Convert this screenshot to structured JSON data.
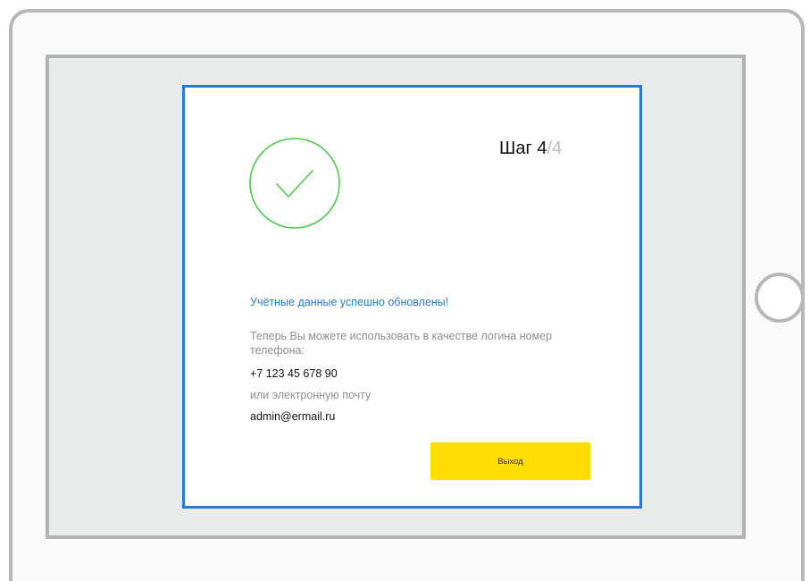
{
  "dialog": {
    "step_label": "Шаг",
    "step_current": "4",
    "step_separator": "/",
    "step_total": "4",
    "success_title": "Учётные данные успешно обновлены!",
    "hint": "Теперь Вы можете использовать в качестве логина номер телефона:",
    "phone": "+7 123 45 678 90",
    "or_email": "или электронную почту",
    "email": "admin@ermail.ru",
    "exit_label": "Выход"
  },
  "icons": {
    "success": "check-circle-icon",
    "home": "home-button"
  },
  "colors": {
    "accent_blue": "#2a7bd0",
    "success_green": "#52c653",
    "button_yellow": "#ffdd00",
    "device_frame": "#b7b7b7",
    "screen_bg": "#e9eaea"
  }
}
